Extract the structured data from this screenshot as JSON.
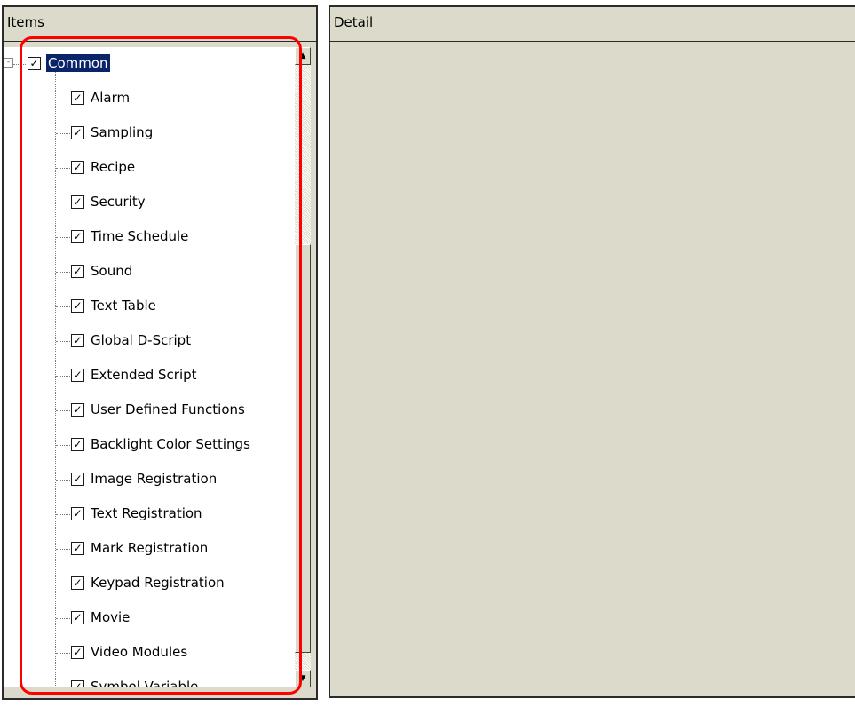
{
  "items_pane": {
    "header": "Items"
  },
  "detail_pane": {
    "header": "Detail"
  },
  "tree": {
    "root": {
      "label": "Common",
      "checked": true,
      "expander": "-"
    },
    "children": [
      {
        "label": "Alarm",
        "checked": true
      },
      {
        "label": "Sampling",
        "checked": true
      },
      {
        "label": "Recipe",
        "checked": true
      },
      {
        "label": "Security",
        "checked": true
      },
      {
        "label": "Time Schedule",
        "checked": true
      },
      {
        "label": "Sound",
        "checked": true
      },
      {
        "label": "Text Table",
        "checked": true
      },
      {
        "label": "Global D-Script",
        "checked": true
      },
      {
        "label": "Extended Script",
        "checked": true
      },
      {
        "label": "User Defined Functions",
        "checked": true
      },
      {
        "label": "Backlight Color Settings",
        "checked": true
      },
      {
        "label": "Image Registration",
        "checked": true
      },
      {
        "label": "Text Registration",
        "checked": true
      },
      {
        "label": "Mark Registration",
        "checked": true
      },
      {
        "label": "Keypad Registration",
        "checked": true
      },
      {
        "label": "Movie",
        "checked": true
      },
      {
        "label": "Video Modules",
        "checked": true
      },
      {
        "label": "Symbol Variable",
        "checked": true
      }
    ]
  },
  "icons": {
    "check": "✓",
    "scroll_up": "▲",
    "scroll_down": "▼"
  },
  "colors": {
    "selection": "#0a246a",
    "highlight": "#ff0000",
    "panel": "#dcdbcb"
  }
}
